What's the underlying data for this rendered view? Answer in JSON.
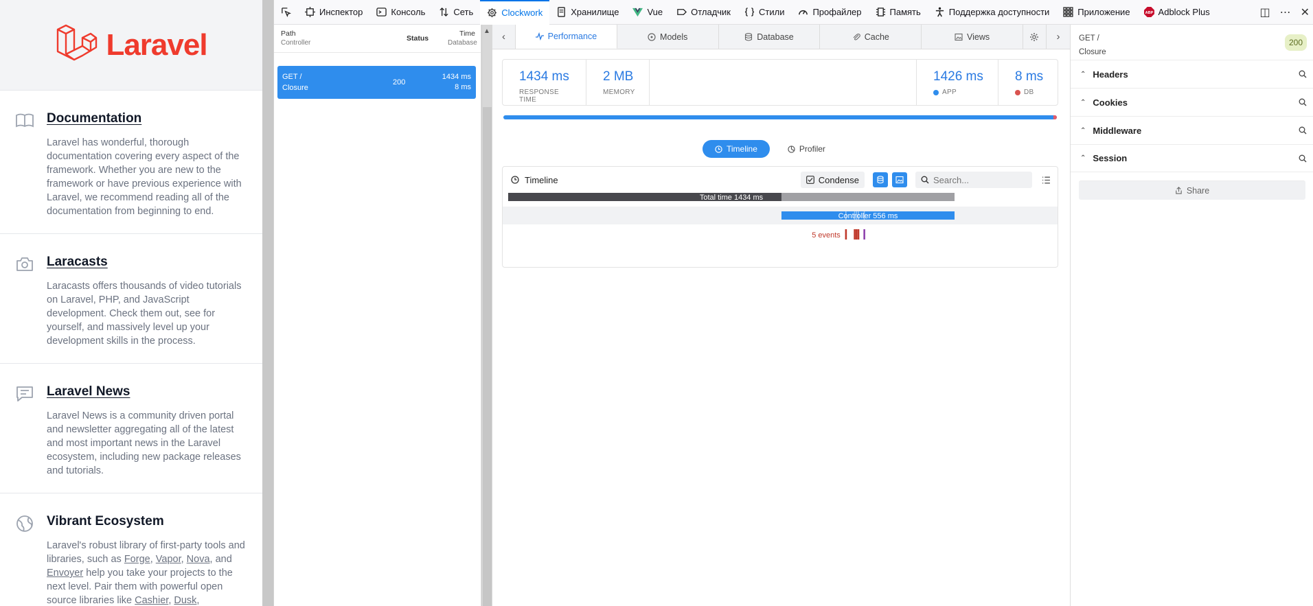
{
  "laravel": {
    "logo_text": "Laravel",
    "sections": [
      {
        "title": "Documentation",
        "icon": "book-icon",
        "desc": "Laravel has wonderful, thorough documentation covering every aspect of the framework. Whether you are new to the framework or have previous experience with Laravel, we recommend reading all of the documentation from beginning to end."
      },
      {
        "title": "Laracasts",
        "icon": "camera-icon",
        "desc": "Laracasts offers thousands of video tutorials on Laravel, PHP, and JavaScript development. Check them out, see for yourself, and massively level up your development skills in the process."
      },
      {
        "title": "Laravel News",
        "icon": "chat-icon",
        "desc": "Laravel News is a community driven portal and newsletter aggregating all of the latest and most important news in the Laravel ecosystem, including new package releases and tutorials."
      },
      {
        "title": "Vibrant Ecosystem",
        "icon": "globe-icon",
        "desc_parts": [
          "Laravel's robust library of first-party tools and libraries, such as ",
          "Forge",
          ", ",
          "Vapor",
          ", ",
          "Nova",
          ", and ",
          "Envoyer",
          " help you take your projects to the next level. Pair them with powerful open source libraries like ",
          "Cashier",
          ", ",
          "Dusk",
          ","
        ]
      }
    ]
  },
  "devtools": {
    "tabs": [
      {
        "label": "Инспектор",
        "icon": "inspector-icon"
      },
      {
        "label": "Консоль",
        "icon": "console-icon"
      },
      {
        "label": "Сеть",
        "icon": "network-icon"
      },
      {
        "label": "Clockwork",
        "icon": "clockwork-icon",
        "active": true
      },
      {
        "label": "Хранилище",
        "icon": "storage-icon"
      },
      {
        "label": "Vue",
        "icon": "vue-icon"
      },
      {
        "label": "Отладчик",
        "icon": "debugger-icon"
      },
      {
        "label": "Стили",
        "icon": "styles-icon"
      },
      {
        "label": "Профайлер",
        "icon": "profiler-icon"
      },
      {
        "label": "Память",
        "icon": "memory-icon"
      },
      {
        "label": "Поддержка доступности",
        "icon": "accessibility-icon"
      },
      {
        "label": "Приложение",
        "icon": "application-icon"
      },
      {
        "label": "Adblock Plus",
        "icon": "adblock-icon"
      }
    ],
    "abp_badge": "ABP"
  },
  "requests": {
    "headers": {
      "path": "Path",
      "controller": "Controller",
      "status": "Status",
      "time": "Time",
      "database": "Database"
    },
    "rows": [
      {
        "method_path": "GET /",
        "controller": "Closure",
        "status": "200",
        "time": "1434 ms",
        "db_time": "8 ms"
      }
    ]
  },
  "main": {
    "tabs": [
      {
        "label": "Performance",
        "icon": "performance-icon",
        "active": true
      },
      {
        "label": "Models",
        "icon": "models-icon"
      },
      {
        "label": "Database",
        "icon": "database-icon"
      },
      {
        "label": "Cache",
        "icon": "cache-icon"
      },
      {
        "label": "Views",
        "icon": "views-icon"
      }
    ],
    "metrics": {
      "response_time": {
        "value": "1434 ms",
        "label": "RESPONSE TIME"
      },
      "memory": {
        "value": "2 MB",
        "label": "MEMORY"
      },
      "app": {
        "value": "1426 ms",
        "label": "APP",
        "color": "#2f8ded"
      },
      "db": {
        "value": "8 ms",
        "label": "DB",
        "color": "#d9534f"
      }
    },
    "perf_split": {
      "app_ms": 1426,
      "db_ms": 8
    },
    "toggle": {
      "timeline": "Timeline",
      "profiler": "Profiler"
    },
    "timeline": {
      "title": "Timeline",
      "condense_label": "Condense",
      "search_placeholder": "Search...",
      "total_label": "Total time 1434 ms",
      "total_ms": 1434,
      "controller_label": "Controller 556 ms",
      "controller_start_ms": 878,
      "controller_ms": 556,
      "events_label": "5 events",
      "events": [
        {
          "t": 1085,
          "color": "#c0392b"
        },
        {
          "t": 1113,
          "color": "#c0392b"
        },
        {
          "t": 1119,
          "color": "#c0392b"
        },
        {
          "t": 1125,
          "color": "#c0392b"
        },
        {
          "t": 1144,
          "color": "#8e44ad"
        }
      ]
    }
  },
  "side": {
    "method_path": "GET /",
    "controller": "Closure",
    "status": "200",
    "items": [
      "Headers",
      "Cookies",
      "Middleware",
      "Session"
    ],
    "share_label": "Share"
  }
}
